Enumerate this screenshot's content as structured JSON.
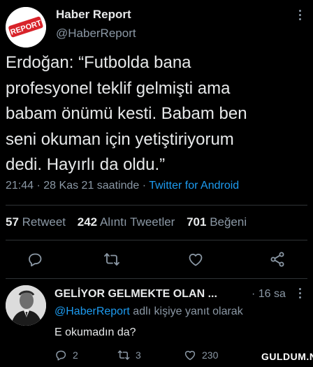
{
  "tweet": {
    "author_name": "Haber Report",
    "author_handle": "@HaberReport",
    "avatar_logo_text": "REPORT",
    "text": "Erdoğan: “Futbolda bana\nprofesyonel teklif gelmişti ama\nbabam önümü kesti. Babam ben\nseni okuman için yetiştiriyorum\ndedi. Hayırlı da oldu.”",
    "time": "21:44",
    "date": "28 Kas 21 saatinde",
    "separator": "·",
    "source": "Twitter for Android",
    "stats": {
      "retweets_count": "57",
      "retweets_label": "Retweet",
      "quotes_count": "242",
      "quotes_label": "Alıntı Tweetler",
      "likes_count": "701",
      "likes_label": "Beğeni"
    }
  },
  "actions": [
    "reply-icon",
    "retweet-icon",
    "like-icon",
    "share-icon"
  ],
  "reply": {
    "author_name": "GELİYOR GELMEKTE OLAN ...",
    "time": "· 16 sa",
    "context_mention": "@HaberReport",
    "context_suffix": " adlı kişiye yanıt olarak",
    "text": "E okumadın da?",
    "reply_count": "2",
    "retweet_count": "3",
    "like_count": "230"
  },
  "watermark": "GULDUM.NET",
  "colors": {
    "background": "#000000",
    "text": "#e7e9ea",
    "muted": "#8b98a5",
    "accent": "#1d9bf0",
    "divider": "#2f3336",
    "logo_red": "#d8232a"
  }
}
